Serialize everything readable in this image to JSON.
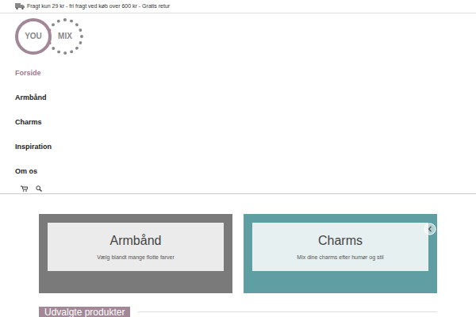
{
  "topbar": {
    "text": "Fragt kun 29 kr - fri fragt ved køb over 600 kr - Gratis retur"
  },
  "logo": {
    "left": "YOU",
    "right": "MIX"
  },
  "nav": {
    "items": [
      {
        "label": "Forside",
        "selected": true
      },
      {
        "label": "Armbånd",
        "selected": false
      },
      {
        "label": "Charms",
        "selected": false
      },
      {
        "label": "Inspiration",
        "selected": false
      },
      {
        "label": "Om os",
        "selected": false
      }
    ]
  },
  "categories": [
    {
      "title": "Armbånd",
      "subtitle": "Vælg blandt mange flotte farver",
      "color": "#7a7a7a"
    },
    {
      "title": "Charms",
      "subtitle": "Mix dine charms efter humør og stil",
      "color": "#5f9ea3"
    }
  ],
  "section": {
    "title": "Udvalgte produkter"
  }
}
